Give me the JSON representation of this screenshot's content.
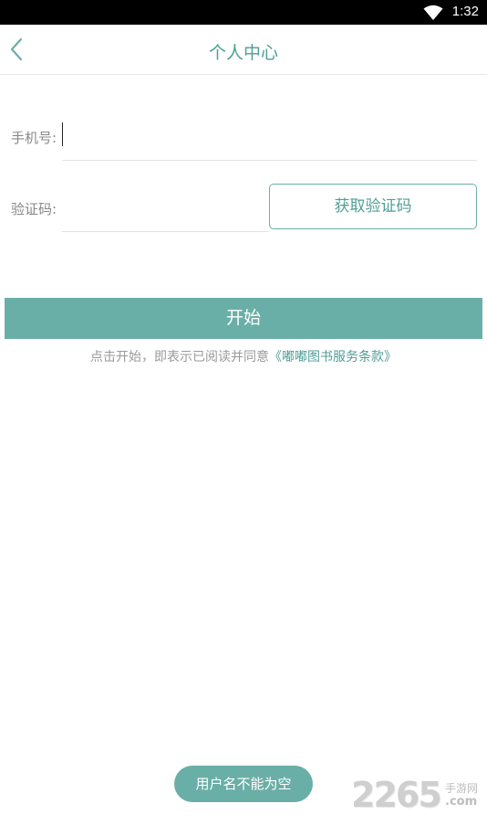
{
  "status_bar": {
    "time": "1:32",
    "wifi_icon": "wifi-icon"
  },
  "header": {
    "back_icon": "chevron-left-icon",
    "title": "个人中心"
  },
  "form": {
    "phone": {
      "label": "手机号:",
      "value": "",
      "placeholder": ""
    },
    "code": {
      "label": "验证码:",
      "value": "",
      "placeholder": ""
    },
    "get_code_label": "获取验证码"
  },
  "start_label": "开始",
  "agreement": {
    "prefix": "点击开始，即表示已阅读并同意",
    "terms": "《嘟嘟图书服务条款》"
  },
  "toast": "用户名不能为空",
  "watermark": {
    "number": "2265",
    "site": "手游网",
    "domain": ".com"
  },
  "colors": {
    "accent": "#6aafa7",
    "accent_text": "#4f9e97",
    "muted_text": "#9a9a9a"
  }
}
